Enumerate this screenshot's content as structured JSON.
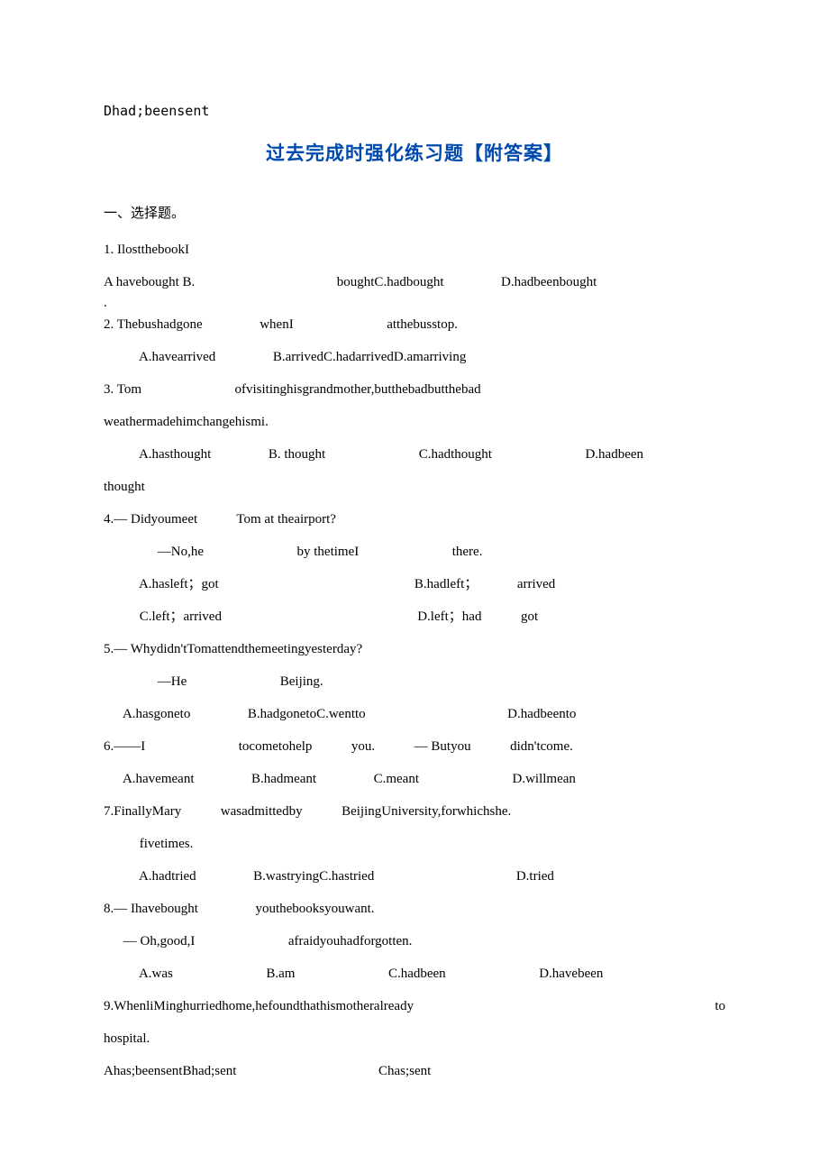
{
  "header_fragment": "Dhad;beensent",
  "title": "过去完成时强化练习题【附答案】",
  "section_heading": "一、选择题。",
  "questions": {
    "q1": {
      "stem_prefix": "1.  IlostthebookI",
      "optA": "A havebought",
      "optB": "B.",
      "optC": "boughtC.hadbought",
      "optD": "D.hadbeenbought",
      "dot": "."
    },
    "q2": {
      "stem1": "2.  Thebushadgone",
      "stem2": "whenI",
      "stem3": "atthebusstop.",
      "optA": "A.havearrived",
      "optRest": "B.arrivedC.hadarrivedD.amarriving"
    },
    "q3": {
      "stem1": "3.  Tom",
      "stem2": "ofvisitinghisgrandmother,butthebadbutthebad",
      "stem3": "weathermadehimchangehismi.",
      "optA": "A.hasthought",
      "optB": "B.  thought",
      "optC": "C.hadthought",
      "optD": "D.hadbeen",
      "tail": "thought"
    },
    "q4": {
      "stem1": "4.— Didyoumeet",
      "stem2": "Tom  at  theairport?",
      "stem3": "—No,he",
      "stem4": "by  thetimeI",
      "stem5": "there.",
      "optA": "A.hasleft；got",
      "optB": "B.hadleft；",
      "optB2": "arrived",
      "optC": "C.left；arrived",
      "optD": "D.left；had",
      "optD2": "got"
    },
    "q5": {
      "stem1": "5.— Whydidn'tTomattendthemeetingyesterday?",
      "stem2": "—He",
      "stem3": "Beijing.",
      "optA": "A.hasgoneto",
      "optB": "B.hadgonetoC.wentto",
      "optD": "D.hadbeento"
    },
    "q6": {
      "stem1": "6.——I",
      "stem2": "tocometohelp",
      "stem3": "you.",
      "stem4": "— Butyou",
      "stem5": "didn'tcome.",
      "optA": "A.havemeant",
      "optB": "B.hadmeant",
      "optC": "C.meant",
      "optD": "D.willmean"
    },
    "q7": {
      "stem1": "7.FinallyMary",
      "stem2": "wasadmittedby",
      "stem3": "BeijingUniversity,forwhichshe.",
      "stem4": "fivetimes.",
      "optA": "A.hadtried",
      "optB": "B.wastryingC.hastried",
      "optD": "D.tried"
    },
    "q8": {
      "stem1": "8.— Ihavebought",
      "stem2": "youthebooksyouwant.",
      "stem3": "— Oh,good,I",
      "stem4": "afraidyouhadforgotten.",
      "optA": "A.was",
      "optB": "B.am",
      "optC": "C.hadbeen",
      "optD": "D.havebeen"
    },
    "q9": {
      "stem1": "9.WhenliMinghurriedhome,hefoundthathismotheralready",
      "stem2": "to",
      "stem3": "hospital.",
      "optsLeft": "Ahas;beensentBhad;sent",
      "optsRight": "Chas;sent"
    }
  }
}
